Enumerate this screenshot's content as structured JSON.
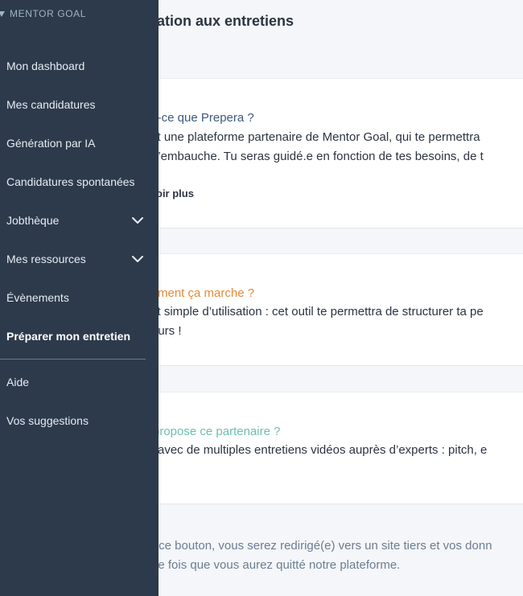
{
  "brand": {
    "name": "MENTOR GOAL",
    "icon": "mentor-goal-logo-icon"
  },
  "sidebar": {
    "items": [
      {
        "label": "Mon dashboard"
      },
      {
        "label": "Mes candidatures"
      },
      {
        "label": "Génération par IA"
      },
      {
        "label": "Candidatures spontanées"
      },
      {
        "label": "Jobthèque",
        "icon": "chevron-down-icon"
      },
      {
        "label": "Mes ressources",
        "icon": "chevron-down-icon"
      },
      {
        "label": "Évènements"
      },
      {
        "label": "Préparer mon entretien",
        "active": true
      }
    ],
    "bottom_items": [
      {
        "label": "Aide"
      },
      {
        "label": "Vos suggestions"
      }
    ]
  },
  "main": {
    "title": "ration aux entretiens",
    "cards": [
      {
        "title": "st-ce que Prepera ?",
        "title_color": "#3b5a7c",
        "lines": [
          "st une plateforme partenaire de Mentor Goal, qui te permettra",
          " d’embauche. Tu seras guidé.e en fonction de tes besoins, de t"
        ],
        "link": "oir plus"
      },
      {
        "title": "ment ça marche ?",
        "title_color": "#e38a3c",
        "lines": [
          "st simple d’utilisation : cet outil te permettra de structurer ta pe",
          "eurs !"
        ]
      },
      {
        "title": " propose ce partenaire ?",
        "title_color": "#6dbfae",
        "lines": [
          " avec de multiples entretiens vidéos auprès d’experts : pitch, e",
          "!"
        ]
      }
    ],
    "disclaimer": [
      "r ce bouton, vous serez redirigé(e) vers un site tiers et vos donn",
      "ne fois que vous aurez quitté notre plateforme."
    ]
  }
}
